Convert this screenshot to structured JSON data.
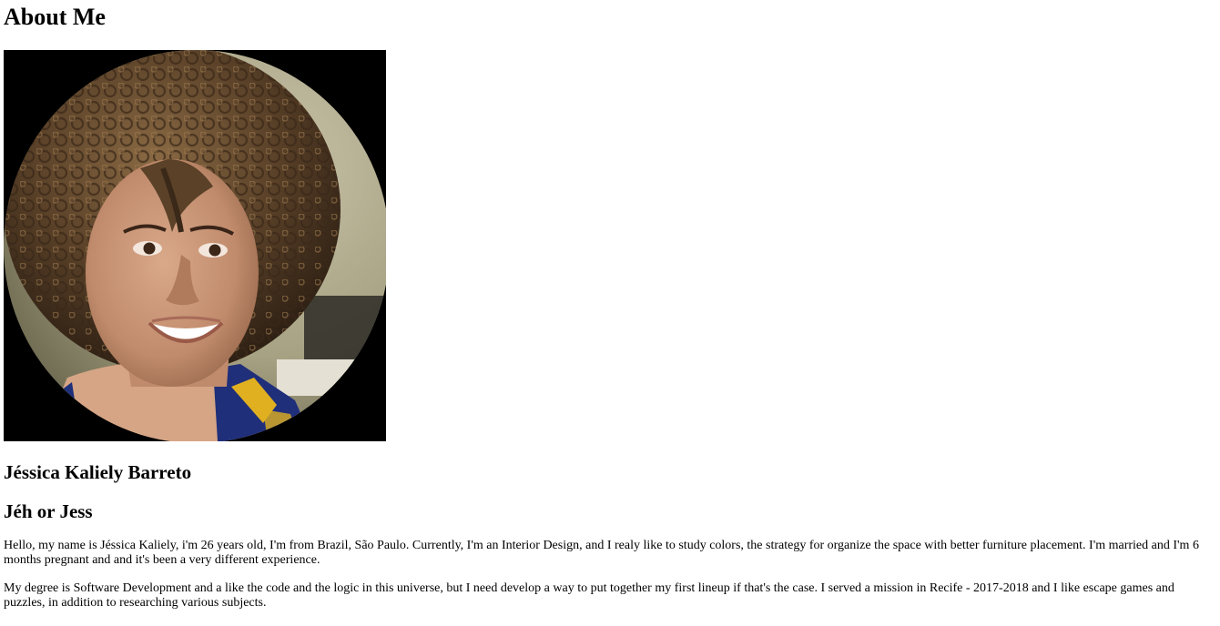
{
  "page": {
    "title": "About Me"
  },
  "profile": {
    "photo_alt": "Portrait photo",
    "full_name": "Jéssica Kaliely Barreto",
    "nickname": "Jéh or Jess"
  },
  "bio": {
    "paragraph_1": "Hello, my name is Jéssica Kaliely, i'm 26 years old, I'm from Brazil, São Paulo. Currently, I'm an Interior Design, and I realy like to study colors, the strategy for organize the space with better furniture placement. I'm married and I'm 6 months pregnant and and it's been a very different experience.",
    "paragraph_2": "My degree is Software Development and a like the code and the logic in this universe, but I need develop a way to put together my first lineup if that's the case. I served a mission in Recife - 2017-2018 and I like escape games and puzzles, in addition to researching various subjects."
  }
}
